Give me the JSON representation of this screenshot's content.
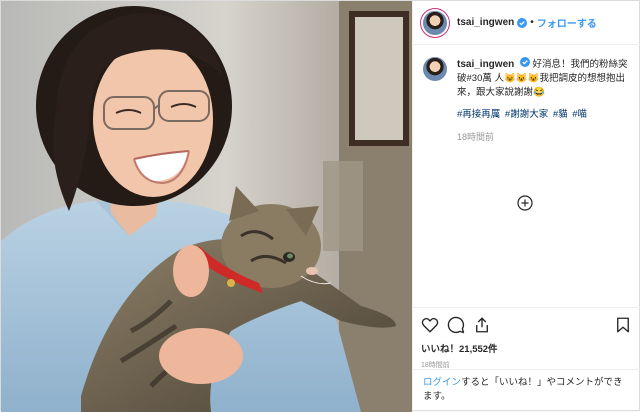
{
  "post": {
    "username": "tsai_ingwen",
    "follow_label": "フォローする",
    "dot": "•",
    "caption": "好消息！我們的粉絲突破#30萬 人😺😺😺我把調皮的想想抱出來，跟大家說謝謝😂",
    "hashtags": "#再接再厲 #謝謝大家 #貓 #喵",
    "caption_time": "18時間前",
    "likes": "いいね！21,552件",
    "post_time": "18時間前",
    "login_link": "ログイン",
    "login_text": "すると「いいね！」やコメントができます。"
  },
  "icons": [
    "verified-badge-icon",
    "load-more-comments-icon",
    "heart-icon",
    "comment-icon",
    "share-icon",
    "bookmark-icon"
  ],
  "colors": {
    "link": "#3897f0",
    "hashtag": "#003569",
    "muted": "#999999",
    "text": "#262626"
  }
}
